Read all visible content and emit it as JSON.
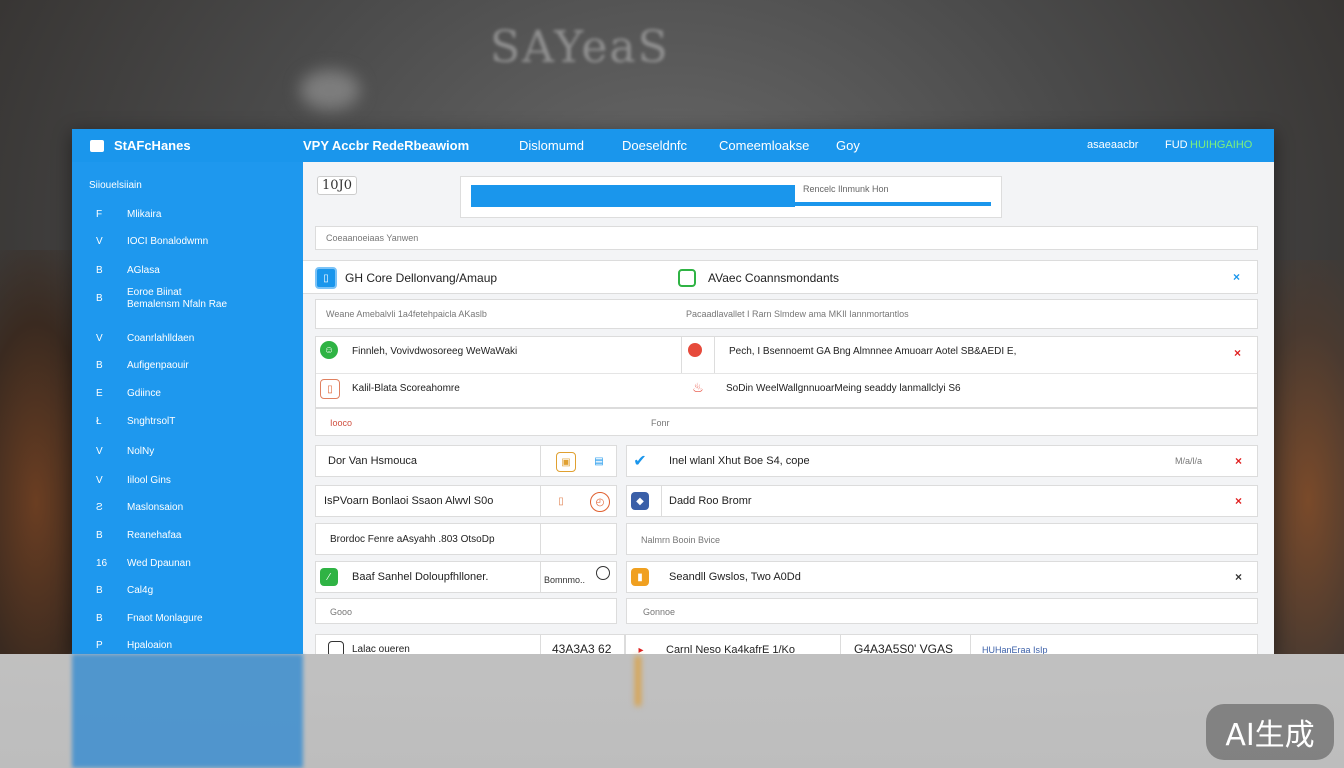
{
  "background": {
    "sign_text": "SAYeaS"
  },
  "header": {
    "app_name": "StAFcHanes",
    "tabs": [
      "VPY Accbr RedeRbeawiom",
      "Dislomumd",
      "Doeseldnfc",
      "Comeemloakse",
      "Goy"
    ],
    "right_link": "asaeaacbr",
    "right_user": "FUD",
    "right_status": "HUIHGAIHO"
  },
  "sidebar": {
    "heading": "Siiouelsiiain",
    "items": [
      {
        "icon": "F",
        "label": "Mlikaira"
      },
      {
        "icon": "V",
        "label": "IOCI Bonalodwmn"
      },
      {
        "icon": "B",
        "label": "AGlasa"
      },
      {
        "icon": "B",
        "label": "Eoroe Biinat\nBemalensm Nfaln Rae"
      },
      {
        "icon": "V",
        "label": "Coanrlahlldaen"
      },
      {
        "icon": "B",
        "label": "Aufigenpaouir"
      },
      {
        "icon": "E",
        "label": "Gdiince"
      },
      {
        "icon": "Ł",
        "label": "SnghtrsolT"
      },
      {
        "icon": "V",
        "label": "NolNy"
      },
      {
        "icon": "V",
        "label": "Iilool Gins"
      },
      {
        "icon": "Ƨ",
        "label": "Maslonsaion"
      },
      {
        "icon": "B",
        "label": "Reanehafaa"
      },
      {
        "icon": "16",
        "label": "Wed Dpaunan"
      },
      {
        "icon": "B",
        "label": "Cal4g"
      },
      {
        "icon": "B",
        "label": "Fnaot Monlagure"
      },
      {
        "icon": "P",
        "label": "Hpaloaion"
      }
    ]
  },
  "main": {
    "badge": "10J0",
    "progress": {
      "label": "Rencelc Ilnmunk Hon",
      "fraction": 0.6
    },
    "filter_row": "Coeaanoeiaas Yanwen",
    "section1": {
      "left_title": "GH Core Dellonvang/Amaup",
      "right_title": "AVaec Coannsmondants",
      "sub_left": "Weane Amebalvli 1a4fetehpaicla AKaslb",
      "sub_right": "Pacaadlavallet I Rarn Slmdew ama MKIl Iannmortantlos"
    },
    "rows": [
      {
        "left": "Finnleh, Vovivdwosoreeg WeWaWaki",
        "right": "Pech, I Bsennoemt GA Bng Almnnee Amuoarr Aotel SB&AEDI E,"
      },
      {
        "left": "Kalil-Blata Scoreahomre",
        "right": "SoDin WeelWallgnnuoarMeing seaddy lanmallclyi S6"
      }
    ],
    "spacer": {
      "left": "Iooco",
      "right": "Fonr"
    },
    "grid": [
      {
        "left": "Dor Van Hsmouca",
        "right": "Inel wlanl Xhut Boe S4, cope",
        "right_meta": "M/a/l/a"
      },
      {
        "left": "IsPVoarn Bonlaoi Ssaon Alwvl S0o",
        "right": "Dadd Roo Bromr"
      },
      {
        "left": "Brordoc Fenre aAsyahh .803 OtsoDp",
        "right": "Nalmrn Booin Bvice"
      },
      {
        "left": "Baaf Sanhel Doloupfhlloner.",
        "left_extra": "Bomnmo..",
        "right": "Seandll Gwslos, Two A0Dd"
      },
      {
        "left": "Gooo",
        "right": "Gonnoe"
      },
      {
        "left": "Lalac oueren",
        "left_mid": "43A3A3 62",
        "right": "Carnl Neso Ka4kafrE 1/Ko",
        "right_mid": "G4A3A5S0' VGAS",
        "right_end": "HUHanEraa IsIp"
      }
    ]
  },
  "watermark": "AI生成",
  "colors": {
    "accent": "#1a96ec",
    "danger": "#e02020",
    "success": "#2fb344"
  }
}
